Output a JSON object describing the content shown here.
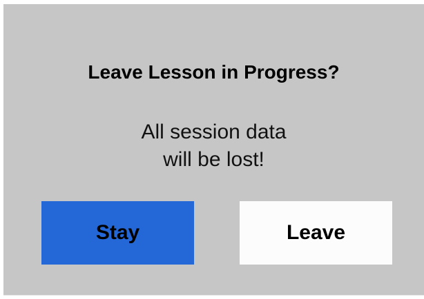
{
  "dialog": {
    "title": "Leave Lesson in Progress?",
    "message_lines": [
      "All session data",
      "will be lost!"
    ],
    "buttons": {
      "stay_label": "Stay",
      "leave_label": "Leave"
    },
    "colors": {
      "background": "#c6c6c6",
      "stay_button": "#2468d8",
      "leave_button": "#fcfcfd",
      "text": "#000000"
    }
  }
}
